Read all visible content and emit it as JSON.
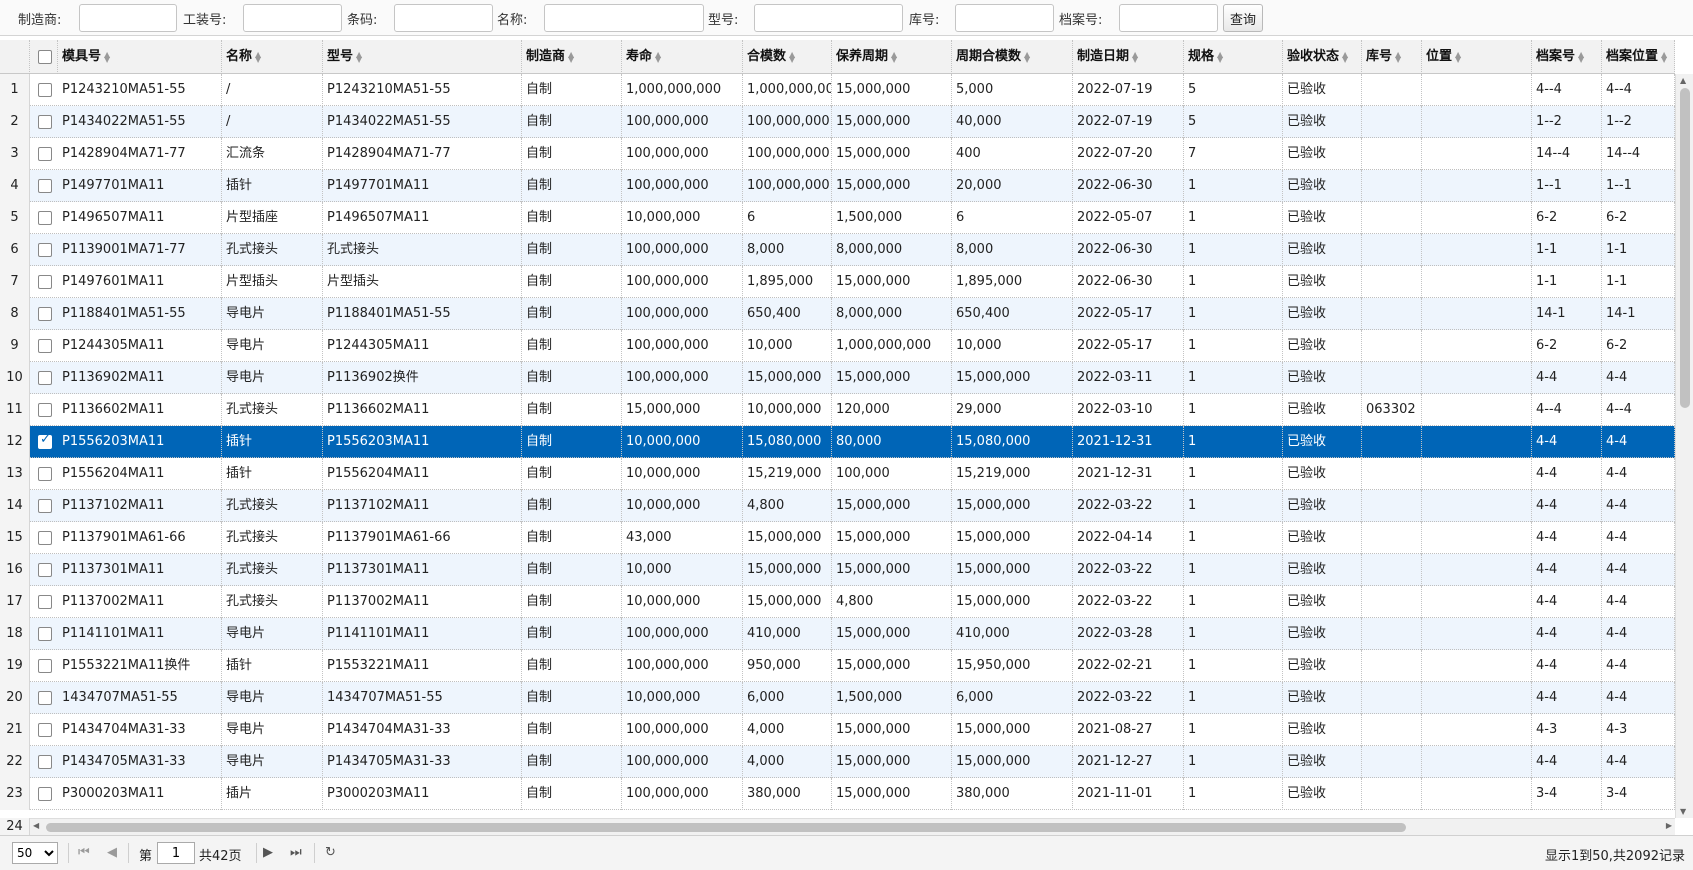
{
  "search": {
    "labels": [
      "制造商:",
      "工装号:",
      "条码:",
      "名称:",
      "型号:",
      "库号:",
      "档案号:"
    ],
    "values": [
      "",
      "",
      "",
      "",
      "",
      "",
      ""
    ],
    "query_label": "查询"
  },
  "grid": {
    "columns": [
      "模具号",
      "名称",
      "型号",
      "制造商",
      "寿命",
      "合模数",
      "保养周期",
      "周期合模数",
      "制造日期",
      "规格",
      "验收状态",
      "库号",
      "位置",
      "档案号",
      "档案位置"
    ],
    "selected_row": 12,
    "rows": [
      {
        "n": "1",
        "c": [
          "P1243210MA51-55",
          "/",
          "P1243210MA51-55",
          "自制",
          "1,000,000,000",
          "1,000,000,00",
          "15,000,000",
          "5,000",
          "2022-07-19",
          "5",
          "已验收",
          "",
          "",
          "4--4",
          "4--4"
        ]
      },
      {
        "n": "2",
        "c": [
          "P1434022MA51-55",
          "/",
          "P1434022MA51-55",
          "自制",
          "100,000,000",
          "100,000,000",
          "15,000,000",
          "40,000",
          "2022-07-19",
          "5",
          "已验收",
          "",
          "",
          "1--2",
          "1--2"
        ]
      },
      {
        "n": "3",
        "c": [
          "P1428904MA71-77",
          "汇流条",
          "P1428904MA71-77",
          "自制",
          "100,000,000",
          "100,000,000",
          "15,000,000",
          "400",
          "2022-07-20",
          "7",
          "已验收",
          "",
          "",
          "14--4",
          "14--4"
        ]
      },
      {
        "n": "4",
        "c": [
          "P1497701MA11",
          "插针",
          "P1497701MA11",
          "自制",
          "100,000,000",
          "100,000,000",
          "15,000,000",
          "20,000",
          "2022-06-30",
          "1",
          "已验收",
          "",
          "",
          "1--1",
          "1--1"
        ]
      },
      {
        "n": "5",
        "c": [
          "P1496507MA11",
          "片型插座",
          "P1496507MA11",
          "自制",
          "10,000,000",
          "6",
          "1,500,000",
          "6",
          "2022-05-07",
          "1",
          "已验收",
          "",
          "",
          "6-2",
          "6-2"
        ]
      },
      {
        "n": "6",
        "c": [
          "P1139001MA71-77",
          "孔式接头",
          "孔式接头",
          "自制",
          "100,000,000",
          "8,000",
          "8,000,000",
          "8,000",
          "2022-06-30",
          "1",
          "已验收",
          "",
          "",
          "1-1",
          "1-1"
        ]
      },
      {
        "n": "7",
        "c": [
          "P1497601MA11",
          "片型插头",
          "片型插头",
          "自制",
          "100,000,000",
          "1,895,000",
          "15,000,000",
          "1,895,000",
          "2022-06-30",
          "1",
          "已验收",
          "",
          "",
          "1-1",
          "1-1"
        ]
      },
      {
        "n": "8",
        "c": [
          "P1188401MA51-55",
          "导电片",
          "P1188401MA51-55",
          "自制",
          "100,000,000",
          "650,400",
          "8,000,000",
          "650,400",
          "2022-05-17",
          "1",
          "已验收",
          "",
          "",
          "14-1",
          "14-1"
        ]
      },
      {
        "n": "9",
        "c": [
          "P1244305MA11",
          "导电片",
          "P1244305MA11",
          "自制",
          "100,000,000",
          "10,000",
          "1,000,000,000",
          "10,000",
          "2022-05-17",
          "1",
          "已验收",
          "",
          "",
          "6-2",
          "6-2"
        ]
      },
      {
        "n": "10",
        "c": [
          "P1136902MA11",
          "导电片",
          "P1136902换件",
          "自制",
          "100,000,000",
          "15,000,000",
          "15,000,000",
          "15,000,000",
          "2022-03-11",
          "1",
          "已验收",
          "",
          "",
          "4-4",
          "4-4"
        ]
      },
      {
        "n": "11",
        "c": [
          "P1136602MA11",
          "孔式接头",
          "P1136602MA11",
          "自制",
          "15,000,000",
          "10,000,000",
          "120,000",
          "29,000",
          "2022-03-10",
          "1",
          "已验收",
          "063302",
          "",
          "4--4",
          "4--4"
        ]
      },
      {
        "n": "12",
        "c": [
          "P1556203MA11",
          "插针",
          "P1556203MA11",
          "自制",
          "10,000,000",
          "15,080,000",
          "80,000",
          "15,080,000",
          "2021-12-31",
          "1",
          "已验收",
          "",
          "",
          "4-4",
          "4-4"
        ]
      },
      {
        "n": "13",
        "c": [
          "P1556204MA11",
          "插针",
          "P1556204MA11",
          "自制",
          "10,000,000",
          "15,219,000",
          "100,000",
          "15,219,000",
          "2021-12-31",
          "1",
          "已验收",
          "",
          "",
          "4-4",
          "4-4"
        ]
      },
      {
        "n": "14",
        "c": [
          "P1137102MA11",
          "孔式接头",
          "P1137102MA11",
          "自制",
          "10,000,000",
          "4,800",
          "15,000,000",
          "15,000,000",
          "2022-03-22",
          "1",
          "已验收",
          "",
          "",
          "4-4",
          "4-4"
        ]
      },
      {
        "n": "15",
        "c": [
          "P1137901MA61-66",
          "孔式接头",
          "P1137901MA61-66",
          "自制",
          "43,000",
          "15,000,000",
          "15,000,000",
          "15,000,000",
          "2022-04-14",
          "1",
          "已验收",
          "",
          "",
          "4-4",
          "4-4"
        ]
      },
      {
        "n": "16",
        "c": [
          "P1137301MA11",
          "孔式接头",
          "P1137301MA11",
          "自制",
          "10,000",
          "15,000,000",
          "15,000,000",
          "15,000,000",
          "2022-03-22",
          "1",
          "已验收",
          "",
          "",
          "4-4",
          "4-4"
        ]
      },
      {
        "n": "17",
        "c": [
          "P1137002MA11",
          "孔式接头",
          "P1137002MA11",
          "自制",
          "10,000,000",
          "15,000,000",
          "4,800",
          "15,000,000",
          "2022-03-22",
          "1",
          "已验收",
          "",
          "",
          "4-4",
          "4-4"
        ]
      },
      {
        "n": "18",
        "c": [
          "P1141101MA11",
          "导电片",
          "P1141101MA11",
          "自制",
          "100,000,000",
          "410,000",
          "15,000,000",
          "410,000",
          "2022-03-28",
          "1",
          "已验收",
          "",
          "",
          "4-4",
          "4-4"
        ]
      },
      {
        "n": "19",
        "c": [
          "P1553221MA11换件",
          "插针",
          "P1553221MA11",
          "自制",
          "100,000,000",
          "950,000",
          "15,000,000",
          "15,950,000",
          "2022-02-21",
          "1",
          "已验收",
          "",
          "",
          "4-4",
          "4-4"
        ]
      },
      {
        "n": "20",
        "c": [
          "1434707MA51-55",
          "导电片",
          "1434707MA51-55",
          "自制",
          "10,000,000",
          "6,000",
          "1,500,000",
          "6,000",
          "2022-03-22",
          "1",
          "已验收",
          "",
          "",
          "4-4",
          "4-4"
        ]
      },
      {
        "n": "21",
        "c": [
          "P1434704MA31-33",
          "导电片",
          "P1434704MA31-33",
          "自制",
          "100,000,000",
          "4,000",
          "15,000,000",
          "15,000,000",
          "2021-08-27",
          "1",
          "已验收",
          "",
          "",
          "4-3",
          "4-3"
        ]
      },
      {
        "n": "22",
        "c": [
          "P1434705MA31-33",
          "导电片",
          "P1434705MA31-33",
          "自制",
          "100,000,000",
          "4,000",
          "15,000,000",
          "15,000,000",
          "2021-12-27",
          "1",
          "已验收",
          "",
          "",
          "4-4",
          "4-4"
        ]
      },
      {
        "n": "23",
        "c": [
          "P3000203MA11",
          "插片",
          "P3000203MA11",
          "自制",
          "100,000,000",
          "380,000",
          "15,000,000",
          "380,000",
          "2021-11-01",
          "1",
          "已验收",
          "",
          "",
          "3-4",
          "3-4"
        ]
      }
    ],
    "partial_row_number": "24"
  },
  "pager": {
    "page_size": "50",
    "page_prefix": "第",
    "page_value": "1",
    "page_suffix": "共42页",
    "info": "显示1到50,共2092记录",
    "icons": [
      "first-page-icon",
      "prev-page-icon",
      "next-page-icon",
      "last-page-icon",
      "refresh-icon"
    ]
  },
  "colors": {
    "selected_row": "#0065b7",
    "alt_row": "#eef5fd"
  }
}
